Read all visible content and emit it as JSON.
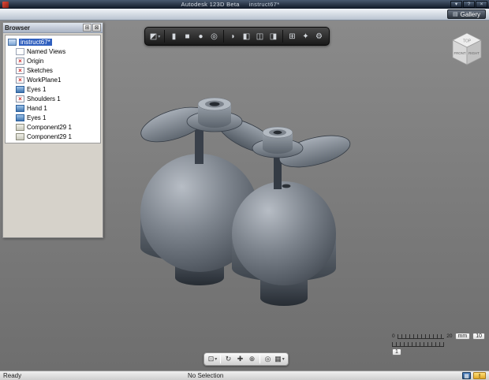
{
  "window": {
    "app_title": "Autodesk 123D Beta",
    "doc_title": "instruct67*",
    "controls": {
      "menu": "▾",
      "help": "?",
      "close": "×"
    }
  },
  "menubar": {
    "gallery_label": "Gallery",
    "gallery_icon": "▤"
  },
  "browser": {
    "title": "Browser",
    "header_icons": {
      "options": "⊞",
      "close": "⊠"
    },
    "hidden_glyph": "×",
    "tree": [
      {
        "label": "instruct67*",
        "icon": "document",
        "level": 0,
        "selected": true
      },
      {
        "label": "Named Views",
        "icon": "views",
        "level": 1
      },
      {
        "label": "Origin",
        "icon": "hidden",
        "level": 1
      },
      {
        "label": "Sketches",
        "icon": "hidden",
        "level": 1
      },
      {
        "label": "WorkPlane1",
        "icon": "hidden",
        "level": 1
      },
      {
        "label": "Eyes 1",
        "icon": "visible",
        "level": 1
      },
      {
        "label": "Shoulders 1",
        "icon": "hidden",
        "level": 1
      },
      {
        "label": "Hand 1",
        "icon": "visible",
        "level": 1
      },
      {
        "label": "Eyes 1",
        "icon": "visible",
        "level": 1
      },
      {
        "label": "Component29 1",
        "icon": "component",
        "level": 1
      },
      {
        "label": "Component29 1",
        "icon": "component",
        "level": 1
      }
    ]
  },
  "toolbar": {
    "items": [
      {
        "name": "primitives-menu-icon",
        "glyph": "◩",
        "dropdown": true
      },
      {
        "sep": true
      },
      {
        "name": "cylinder-tool-icon",
        "glyph": "▮"
      },
      {
        "name": "box-tool-icon",
        "glyph": "■"
      },
      {
        "name": "sphere-tool-icon",
        "glyph": "●"
      },
      {
        "name": "torus-tool-icon",
        "glyph": "◎"
      },
      {
        "sep": true
      },
      {
        "name": "fillet-tool-icon",
        "glyph": "◗"
      },
      {
        "name": "shell-tool-icon",
        "glyph": "◧"
      },
      {
        "name": "combine-tool-icon",
        "glyph": "◫"
      },
      {
        "name": "split-tool-icon",
        "glyph": "◨"
      },
      {
        "sep": true
      },
      {
        "name": "pattern-tool-icon",
        "glyph": "⊞"
      },
      {
        "name": "material-tool-icon",
        "glyph": "✦"
      },
      {
        "name": "snap-tool-icon",
        "glyph": "⚙"
      }
    ]
  },
  "nav_toolbar": {
    "items": [
      {
        "name": "zoom-window-icon",
        "glyph": "⊡",
        "dropdown": true
      },
      {
        "sep": true
      },
      {
        "name": "orbit-icon",
        "glyph": "↻"
      },
      {
        "name": "pan-icon",
        "glyph": "✚"
      },
      {
        "name": "zoom-icon",
        "glyph": "⊕"
      },
      {
        "sep": true
      },
      {
        "name": "look-at-icon",
        "glyph": "◎"
      },
      {
        "name": "display-style-icon",
        "glyph": "▦",
        "dropdown": true
      }
    ]
  },
  "viewcube": {
    "top": "TOP",
    "front": "FRONT",
    "right": "RIGHT"
  },
  "scale": {
    "min": "0",
    "max": "20",
    "unit": "mm",
    "value": "10",
    "grid": "1"
  },
  "statusbar": {
    "left": "Ready",
    "selection": "No Selection",
    "icons": [
      {
        "name": "snap-indicator-icon",
        "glyph": "▦"
      },
      {
        "name": "alert-indicator-icon",
        "glyph": "!"
      }
    ]
  },
  "colors": {
    "selection_blue": "#2f5fbf",
    "viewport_gray": "#7b7b7b",
    "model_gray": "#5f6770",
    "accent_yellow": "#e0a828"
  }
}
